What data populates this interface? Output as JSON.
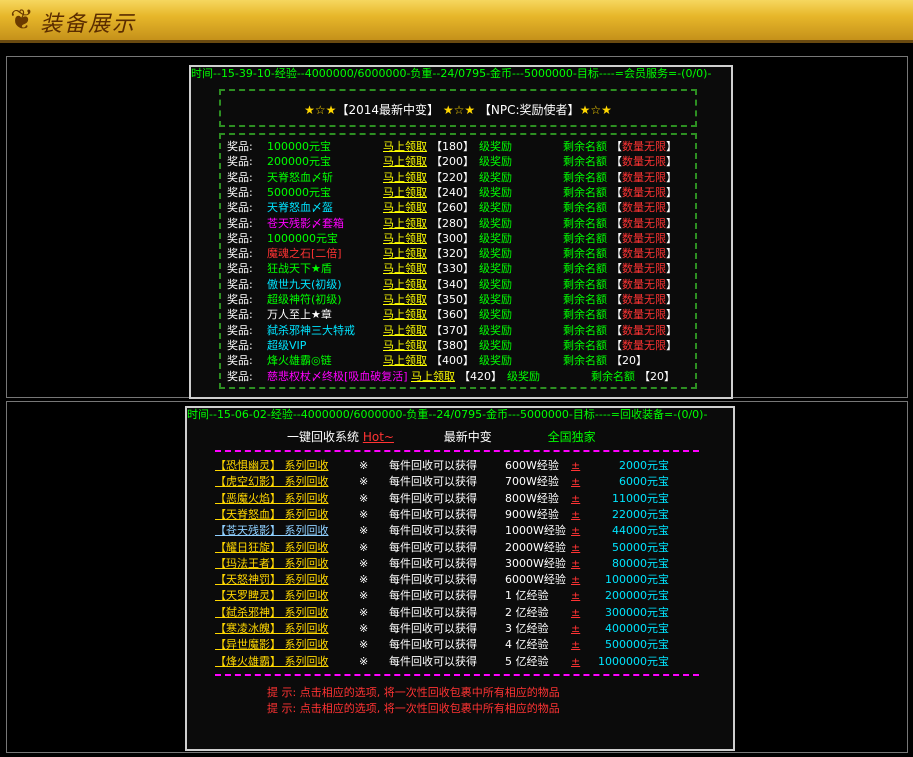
{
  "titlebar": {
    "title": "装备展示",
    "icon": "crest-icon"
  },
  "panel1": {
    "header": "时间--15-39-10-经验--4000000/6000000-负重--24/0795-金币---5000000-目标----=会员服务=-(0/0)-",
    "banner": {
      "stars": "★☆★",
      "tag1": "【2014最新中变】",
      "tag2": "【NPC:奖励使者】"
    },
    "prize_label": "奖品:",
    "action_label": "马上领取",
    "reward_label": "级奖励",
    "remaining_label": "剩余名额",
    "prizes": [
      {
        "name": "100000元宝",
        "color": "#0f0",
        "level": "【180】",
        "qty": "数量无限"
      },
      {
        "name": "200000元宝",
        "color": "#0f0",
        "level": "【200】",
        "qty": "数量无限"
      },
      {
        "name": "天脊怒血〆斩",
        "color": "#0f0",
        "level": "【220】",
        "qty": "数量无限"
      },
      {
        "name": "500000元宝",
        "color": "#0f0",
        "level": "【240】",
        "qty": "数量无限"
      },
      {
        "name": "天脊怒血〆盔",
        "color": "#00e5ff",
        "level": "【260】",
        "qty": "数量无限"
      },
      {
        "name": "苍天残影〆套箱",
        "color": "#ff00ff",
        "level": "【280】",
        "qty": "数量无限"
      },
      {
        "name": "1000000元宝",
        "color": "#0f0",
        "level": "【300】",
        "qty": "数量无限"
      },
      {
        "name": "魔魂之石[二倍]",
        "color": "#ff3333",
        "level": "【320】",
        "qty": "数量无限"
      },
      {
        "name": "狂战天下★盾",
        "color": "#0f0",
        "level": "【330】",
        "qty": "数量无限"
      },
      {
        "name": "傲世九天(初级)",
        "color": "#00e5ff",
        "level": "【340】",
        "qty": "数量无限"
      },
      {
        "name": "超级神符(初级)",
        "color": "#0f0",
        "level": "【350】",
        "qty": "数量无限"
      },
      {
        "name": "万人至上★章",
        "color": "#fff",
        "level": "【360】",
        "qty": "数量无限"
      },
      {
        "name": "弑杀邪神三大特戒",
        "color": "#00e5ff",
        "level": "【370】",
        "qty": "数量无限"
      },
      {
        "name": "超级VIP",
        "color": "#00e5ff",
        "level": "【380】",
        "qty": "数量无限"
      },
      {
        "name": "烽火雄霸◎链",
        "color": "#0f0",
        "level": "【400】",
        "qty": "20"
      },
      {
        "name": "慈悲权杖〆终极[吸血破复活]",
        "color": "#ff00ff",
        "level": "【420】",
        "qty": "20"
      }
    ]
  },
  "panel2": {
    "header": "时间--15-06-02-经验--4000000/6000000-负重--24/0795-金币---5000000-目标----=回收装备=-(0/0)-",
    "top": {
      "system": "一键回收系统",
      "hot": "Hot~",
      "latest": "最新中变",
      "exclusive": "全国独家"
    },
    "series_label": "系列回收",
    "symbol": "※",
    "desc": "每件回收可以获得",
    "plus": "±",
    "rows": [
      {
        "name": "【恐惧幽灵】",
        "exp": "600W经验",
        "gold": "2000元宝",
        "nc": "#ffd700"
      },
      {
        "name": "【虎空幻影】",
        "exp": "700W经验",
        "gold": "6000元宝",
        "nc": "#ffd700"
      },
      {
        "name": "【恶魔火焰】",
        "exp": "800W经验",
        "gold": "11000元宝",
        "nc": "#ffd700"
      },
      {
        "name": "【天脊怒血】",
        "exp": "900W经验",
        "gold": "22000元宝",
        "nc": "#ffd700"
      },
      {
        "name": "【苍天残影】",
        "exp": "1000W经验",
        "gold": "44000元宝",
        "nc": "#8fd0ff"
      },
      {
        "name": "【耀日狂旋】",
        "exp": "2000W经验",
        "gold": "50000元宝",
        "nc": "#ffd700"
      },
      {
        "name": "【玛法王者】",
        "exp": "3000W经验",
        "gold": "80000元宝",
        "nc": "#ffd700"
      },
      {
        "name": "【天怒神罚】",
        "exp": "6000W经验",
        "gold": "100000元宝",
        "nc": "#ffd700"
      },
      {
        "name": "【天罗睥灵】",
        "exp": "1 亿经验",
        "gold": "200000元宝",
        "nc": "#ffd700"
      },
      {
        "name": "【弑杀邪神】",
        "exp": "2 亿经验",
        "gold": "300000元宝",
        "nc": "#ffd700"
      },
      {
        "name": "【寒凌冰魄】",
        "exp": "3 亿经验",
        "gold": "400000元宝",
        "nc": "#ffd700"
      },
      {
        "name": "【异世魔影】",
        "exp": "4 亿经验",
        "gold": "500000元宝",
        "nc": "#ffd700"
      },
      {
        "name": "【烽火雄霸】",
        "exp": "5 亿经验",
        "gold": "1000000元宝",
        "nc": "#ffd700"
      }
    ],
    "hints": [
      "提  示:  点击相应的选项, 将一次性回收包裹中所有相应的物品",
      "提  示:  点击相应的选项, 将一次性回收包裹中所有相应的物品"
    ]
  }
}
